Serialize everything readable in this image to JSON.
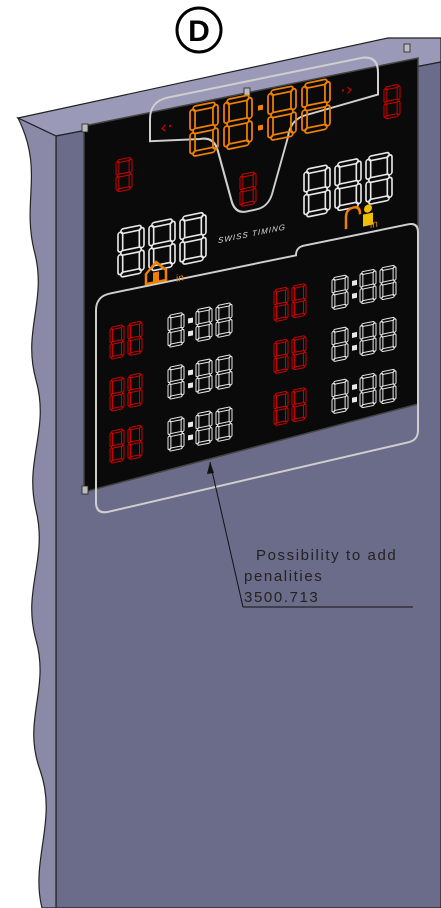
{
  "view_label": "D",
  "brand": "SWISS TIMING",
  "home_in_label": "in",
  "guest_in_label": "in",
  "callout": {
    "line1": "Possibility to add",
    "line2": "penalities",
    "line3": "3500.713"
  },
  "colors": {
    "panel": "#0a0a0a",
    "wall_front": "#6b6b8a",
    "wall_top": "#9a9ab8",
    "wall_side": "#8a8aa8",
    "digit_red": "#d00000",
    "digit_white": "#e8e8e8",
    "digit_orange": "#f08000",
    "home_icon": "#f08000",
    "guest_icon": "#f0c000"
  },
  "display": {
    "main_clock": "88:88",
    "period_left": "8",
    "period_right": "8",
    "score_home": "888",
    "score_guest": "888",
    "center_digit": "8",
    "penalty_time": "8:88",
    "penalty_player": "88"
  }
}
